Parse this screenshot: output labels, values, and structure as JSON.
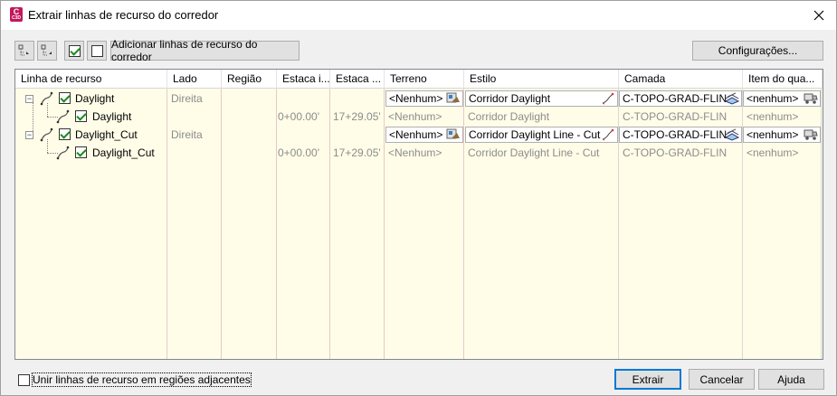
{
  "window": {
    "title": "Extrair linhas de recurso do corredor",
    "icon_label": "C",
    "icon_sublabel": "C3D"
  },
  "toolbar": {
    "add_button_label": "Adicionar linhas de recurso do corredor",
    "settings_button_label": "Configurações..."
  },
  "table": {
    "headers": [
      "Linha de recurso",
      "Lado",
      "Região",
      "Estaca i...",
      "Estaca ...",
      "Terreno",
      "Estilo",
      "Camada",
      "Item do qua..."
    ],
    "rows": [
      {
        "name": "Daylight",
        "side": "Direita",
        "region": "",
        "start": "",
        "end": "",
        "terrain": "<Nenhum>",
        "style": "Corridor Daylight",
        "layer": "C-TOPO-GRAD-FLIN",
        "item": "<nenhum>"
      },
      {
        "name": "Daylight",
        "side": "",
        "region": "",
        "start": "0+00.00'",
        "end": "17+29.05'",
        "terrain": "<Nenhum>",
        "style": "Corridor Daylight",
        "layer": "C-TOPO-GRAD-FLIN",
        "item": "<nenhum>"
      },
      {
        "name": "Daylight_Cut",
        "side": "Direita",
        "region": "",
        "start": "",
        "end": "",
        "terrain": "<Nenhum>",
        "style": "Corridor Daylight Line - Cut",
        "layer": "C-TOPO-GRAD-FLIN",
        "item": "<nenhum>"
      },
      {
        "name": "Daylight_Cut",
        "side": "",
        "region": "",
        "start": "0+00.00'",
        "end": "17+29.05'",
        "terrain": "<Nenhum>",
        "style": "Corridor Daylight Line - Cut",
        "layer": "C-TOPO-GRAD-FLIN",
        "item": "<nenhum>"
      }
    ]
  },
  "footer": {
    "merge_checkbox_label": "Unir linhas de recurso em regiões adjacentes",
    "extract_label": "Extrair",
    "cancel_label": "Cancelar",
    "help_label": "Ajuda"
  },
  "icons": {
    "expand_all": "tree-expand-icon",
    "collapse_all": "tree-collapse-icon",
    "check_all": "check-all-icon",
    "uncheck_all": "uncheck-all-icon",
    "featureline": "featureline-icon",
    "surface": "surface-icon",
    "style_edit": "style-edit-icon",
    "layer": "layer-icon",
    "pay_item": "pay-item-icon",
    "close": "close-icon"
  },
  "colors": {
    "grid_background": "#fffde8",
    "column_divider": "#e8c8c8",
    "app_icon": "#c2185b",
    "default_button_border": "#0078d7",
    "checkmark": "#1a8a1a"
  }
}
